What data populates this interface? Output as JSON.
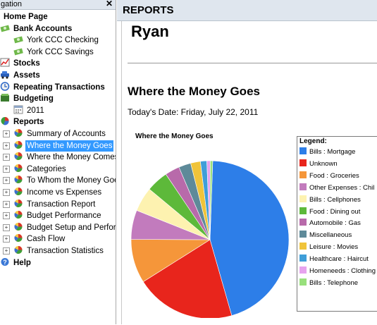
{
  "nav": {
    "header": "gation",
    "close": "✕",
    "items": [
      {
        "label": "Home Page",
        "level": 0,
        "top": true
      },
      {
        "label": "Bank Accounts",
        "level": 0,
        "top": true
      },
      {
        "label": "York CCC Checking",
        "level": 1
      },
      {
        "label": "York CCC Savings",
        "level": 1
      },
      {
        "label": "Stocks",
        "level": 0,
        "top": true
      },
      {
        "label": "Assets",
        "level": 0,
        "top": true
      },
      {
        "label": "Repeating Transactions",
        "level": 0,
        "top": true
      },
      {
        "label": "Budgeting",
        "level": 0,
        "top": true
      },
      {
        "label": "2011",
        "level": 1
      },
      {
        "label": "Reports",
        "level": 0,
        "top": true
      },
      {
        "label": "Summary of Accounts",
        "level": 1
      },
      {
        "label": "Where the Money Goes",
        "level": 1,
        "selected": true
      },
      {
        "label": "Where the Money Comes",
        "level": 1
      },
      {
        "label": "Categories",
        "level": 1
      },
      {
        "label": "To Whom the Money Goe",
        "level": 1
      },
      {
        "label": "Income vs Expenses",
        "level": 1
      },
      {
        "label": "Transaction Report",
        "level": 1
      },
      {
        "label": "Budget Performance",
        "level": 1
      },
      {
        "label": "Budget Setup and Perforr",
        "level": 1
      },
      {
        "label": "Cash Flow",
        "level": 1
      },
      {
        "label": "Transaction Statistics",
        "level": 1
      },
      {
        "label": "Help",
        "level": 0,
        "top": true
      }
    ]
  },
  "main": {
    "header": "REPORTS",
    "report_name": "Ryan",
    "report_title": "Where the Money Goes",
    "date_line": "Today's Date: Friday, July 22, 2011"
  },
  "chart_data": {
    "type": "pie",
    "title": "Where the Money Goes",
    "legend_title": "Legend:",
    "legend_position": "right",
    "slices": [
      {
        "label": "Bills : Mortgage",
        "value": 45.0,
        "color": "#2d7ee8"
      },
      {
        "label": "Unknown",
        "value": 20.5,
        "color": "#e8251c"
      },
      {
        "label": "Food : Groceries",
        "value": 9.0,
        "color": "#f5963a"
      },
      {
        "label": "Other Expenses : Chil",
        "value": 6.0,
        "color": "#c27bbd"
      },
      {
        "label": "Bills : Cellphones",
        "value": 5.0,
        "color": "#fdf2b0"
      },
      {
        "label": "Food : Dining out",
        "value": 4.5,
        "color": "#5db93a"
      },
      {
        "label": "Automobile : Gas",
        "value": 3.0,
        "color": "#b86aaa"
      },
      {
        "label": "Miscellaneous",
        "value": 2.5,
        "color": "#5e8a99"
      },
      {
        "label": "Leisure : Movies",
        "value": 2.0,
        "color": "#f0c43a"
      },
      {
        "label": "Healthcare : Haircut",
        "value": 1.3,
        "color": "#3f9ed8"
      },
      {
        "label": "Homeneeds : Clothing",
        "value": 0.7,
        "color": "#e6a3ee"
      },
      {
        "label": "Bills : Telephone",
        "value": 0.5,
        "color": "#98e07c"
      }
    ]
  }
}
